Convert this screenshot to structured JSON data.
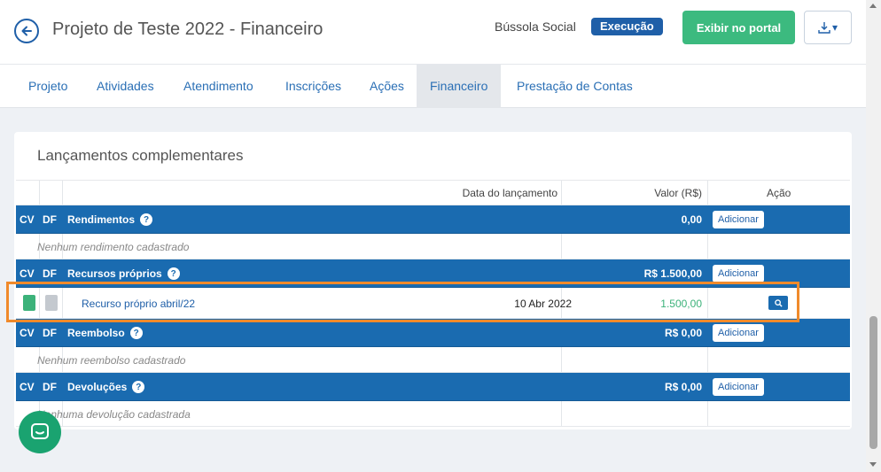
{
  "header": {
    "title": "Projeto de Teste 2022 - Financeiro",
    "org": "Bússola Social",
    "status": "Execução",
    "portal_button": "Exibir no portal"
  },
  "tabs": [
    {
      "label": "Projeto"
    },
    {
      "label": "Atividades"
    },
    {
      "label": "Atendimento"
    },
    {
      "label": "Inscrições"
    },
    {
      "label": "Ações"
    },
    {
      "label": "Financeiro",
      "active": true
    },
    {
      "label": "Prestação de Contas"
    }
  ],
  "section": {
    "title": "Lançamentos complementares",
    "columns": {
      "date": "Data do lançamento",
      "value": "Valor (R$)",
      "action": "Ação"
    },
    "cv": "CV",
    "df": "DF",
    "add_label": "Adicionar",
    "groups": [
      {
        "name": "Rendimentos",
        "value": "0,00",
        "empty": "Nenhum rendimento cadastrado"
      },
      {
        "name": "Recursos próprios",
        "value": "R$ 1.500,00",
        "items": [
          {
            "name": "Recurso próprio abril/22",
            "date": "10 Abr 2022",
            "value": "1.500,00"
          }
        ]
      },
      {
        "name": "Reembolso",
        "value": "R$ 0,00",
        "empty": "Nenhum reembolso cadastrado"
      },
      {
        "name": "Devoluções",
        "value": "R$ 0,00",
        "empty": "Nenhuma devolução cadastrada"
      }
    ]
  },
  "colors": {
    "primary": "#1a6bb0",
    "success": "#3cba7f",
    "highlight": "#f08a2b"
  }
}
